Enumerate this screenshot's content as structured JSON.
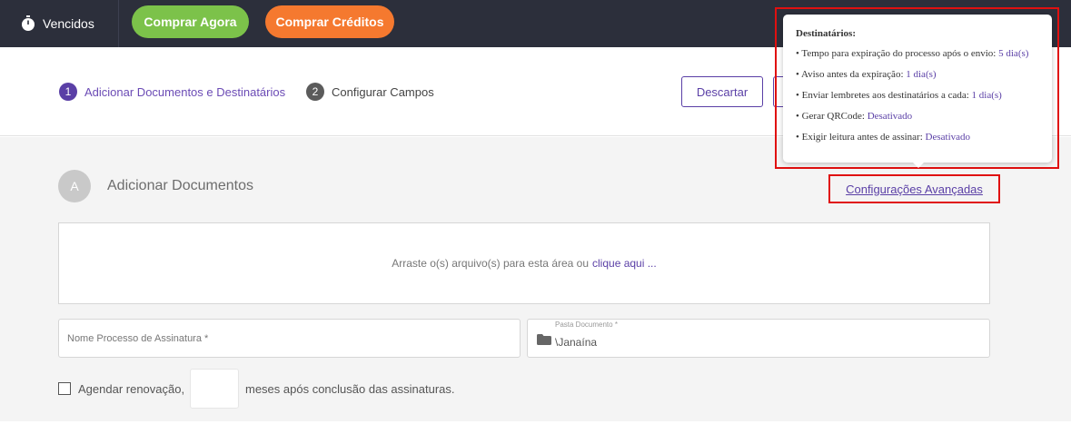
{
  "topbar": {
    "brand_label": "Vencidos",
    "brand_icon": "stopwatch-icon",
    "buy_now_label": "Comprar Agora",
    "buy_credits_label": "Comprar Créditos",
    "colors": {
      "bar": "#2c2f3b",
      "green": "#7cc24a",
      "orange": "#f5792f",
      "accent": "#5a3fa6"
    }
  },
  "stepper": {
    "steps": [
      {
        "number": "1",
        "label": "Adicionar Documentos e Destinatários",
        "active": true
      },
      {
        "number": "2",
        "label": "Configurar Campos",
        "active": false
      }
    ],
    "discard_label": "Descartar"
  },
  "section": {
    "badge": "A",
    "title": "Adicionar Documentos",
    "advanced_link": "Configurações Avançadas"
  },
  "dropzone": {
    "text": "Arraste o(s) arquivo(s) para esta área ou",
    "link": "clique aqui ..."
  },
  "form": {
    "name_placeholder": "Nome Processo de Assinatura *",
    "folder_label": "Pasta Documento *",
    "folder_icon": "folder-icon",
    "folder_value": "\\Janaína",
    "renew_label": "Agendar renovação,",
    "renew_checked": false,
    "renew_suffix": "meses após conclusão das assinaturas."
  },
  "popup": {
    "title": "Destinatários:",
    "rows": [
      {
        "label": "• Tempo para expiração do processo após o envio:",
        "value": "5 dia(s)"
      },
      {
        "label": "• Aviso antes da expiração:",
        "value": "1 dia(s)"
      },
      {
        "label": "• Enviar lembretes aos destinatários a cada:",
        "value": "1 dia(s)"
      },
      {
        "label": "• Gerar QRCode:",
        "value": "Desativado"
      },
      {
        "label": "• Exigir leitura antes de assinar:",
        "value": "Desativado"
      }
    ]
  }
}
